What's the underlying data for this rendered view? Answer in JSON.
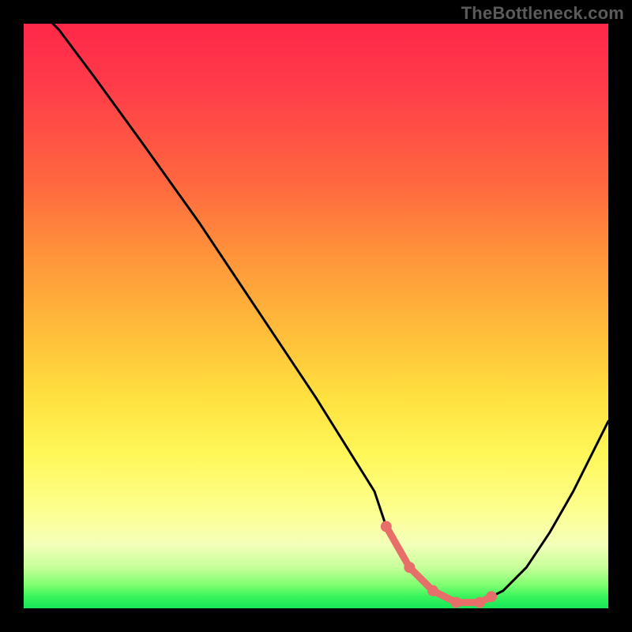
{
  "watermark": "TheBottleneck.com",
  "colors": {
    "background": "#000000",
    "curve": "#000000",
    "highlight": "#e76f6a",
    "gradient_top": "#ff2848",
    "gradient_bottom": "#16e65a"
  },
  "chart_data": {
    "type": "line",
    "title": "",
    "xlabel": "",
    "ylabel": "",
    "xlim": [
      0,
      100
    ],
    "ylim": [
      0,
      100
    ],
    "series": [
      {
        "name": "bottleneck-curve",
        "x": [
          0,
          6,
          12,
          20,
          30,
          40,
          50,
          60,
          62,
          66,
          70,
          74,
          78,
          80,
          82,
          86,
          90,
          94,
          100
        ],
        "y": [
          105,
          99,
          91,
          80,
          66,
          51,
          36,
          20,
          14,
          7,
          3,
          1,
          1,
          2,
          3,
          7,
          13,
          20,
          32
        ]
      }
    ],
    "highlight_region": {
      "name": "optimal-range",
      "x": [
        62,
        66,
        70,
        74,
        78,
        80
      ],
      "y": [
        14,
        7,
        3,
        1,
        1,
        2
      ]
    },
    "annotations": []
  }
}
